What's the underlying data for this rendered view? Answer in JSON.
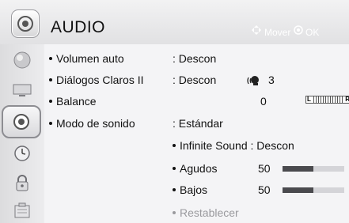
{
  "header": {
    "title": "AUDIO",
    "hint_move": "Mover",
    "hint_ok": "OK"
  },
  "sidebar": {
    "items": [
      {
        "icon": "picture-icon"
      },
      {
        "icon": "screen-icon"
      },
      {
        "icon": "audio-icon",
        "selected": true
      },
      {
        "icon": "clock-icon"
      },
      {
        "icon": "lock-icon"
      },
      {
        "icon": "options-icon"
      }
    ]
  },
  "settings": {
    "volumen_auto": {
      "label": "Volumen auto",
      "value": ": Descon"
    },
    "dialogos": {
      "label": "Diálogos Claros II",
      "value": ": Descon",
      "level": "3"
    },
    "balance": {
      "label": "Balance",
      "value": "0",
      "left": "L",
      "right": "R"
    },
    "modo": {
      "label": "Modo de sonido",
      "value": ": Estándar"
    },
    "infinite": {
      "label": "Infinite Sound",
      "value": ": Descon"
    },
    "agudos": {
      "label": "Agudos",
      "value": "50",
      "level_percent": 50
    },
    "bajos": {
      "label": "Bajos",
      "value": "50",
      "level_percent": 50
    },
    "restablecer": {
      "label": "Restablecer"
    }
  }
}
